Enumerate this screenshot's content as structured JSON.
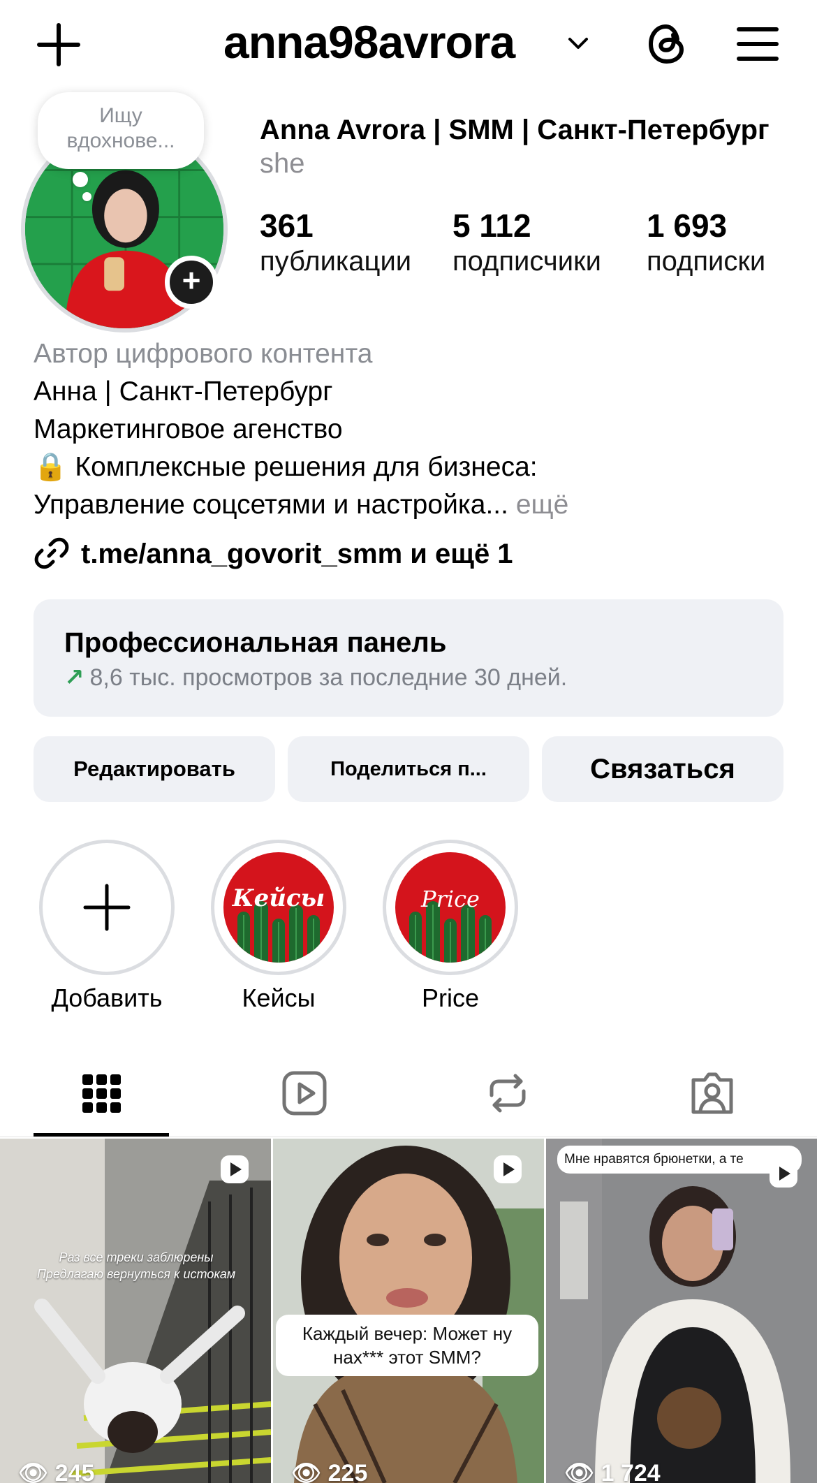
{
  "header": {
    "username": "anna98avrora"
  },
  "profile": {
    "note_bubble": "Ищу вдохнове...",
    "name": "Anna Avrora | SMM | Санкт-Петербург",
    "pronoun": "she",
    "stats": [
      {
        "value": "361",
        "label": "публикации"
      },
      {
        "value": "5 112",
        "label": "подписчики"
      },
      {
        "value": "1 693",
        "label": "подписки"
      }
    ],
    "category": "Автор цифрового контента",
    "bio_lines": [
      "Анна | Санкт-Петербург",
      "Маркетинговое агенство",
      "🔒 Комплексные решения для бизнеса:",
      "Управление соцсетями и настройка..."
    ],
    "more_label": "ещё",
    "link_text": "t.me/anna_govorit_smm и ещё 1"
  },
  "pro_panel": {
    "title": "Профессиональная панель",
    "subtitle": "8,6 тыс. просмотров за последние 30 дней.",
    "trend_color": "#2e9e55"
  },
  "buttons": {
    "edit": "Редактировать",
    "share": "Поделиться п...",
    "contact": "Связаться"
  },
  "highlights": [
    {
      "label": "Добавить",
      "icon": "plus-icon"
    },
    {
      "label": "Кейсы",
      "cover_text": "Кейсы"
    },
    {
      "label": "Price",
      "cover_text": "Price"
    }
  ],
  "tabs": [
    {
      "name": "grid",
      "icon": "grid-icon",
      "active": true
    },
    {
      "name": "reels",
      "icon": "reels-icon",
      "active": false
    },
    {
      "name": "reposts",
      "icon": "repost-icon",
      "active": false
    },
    {
      "name": "tagged",
      "icon": "tagged-icon",
      "active": false
    }
  ],
  "posts": [
    {
      "caption": "Раз все треки заблюрены Предлагаю вернуться к истокам",
      "views": "245"
    },
    {
      "caption": "Каждый вечер: Может ну нах*** этот SMM?",
      "views": "225"
    },
    {
      "caption": "Мне нравятся брюнетки, а те",
      "views": "1 724"
    }
  ],
  "colors": {
    "panel_bg": "#eff1f5",
    "highlight_red": "#d4141c",
    "muted_text": "#8e8e93"
  }
}
